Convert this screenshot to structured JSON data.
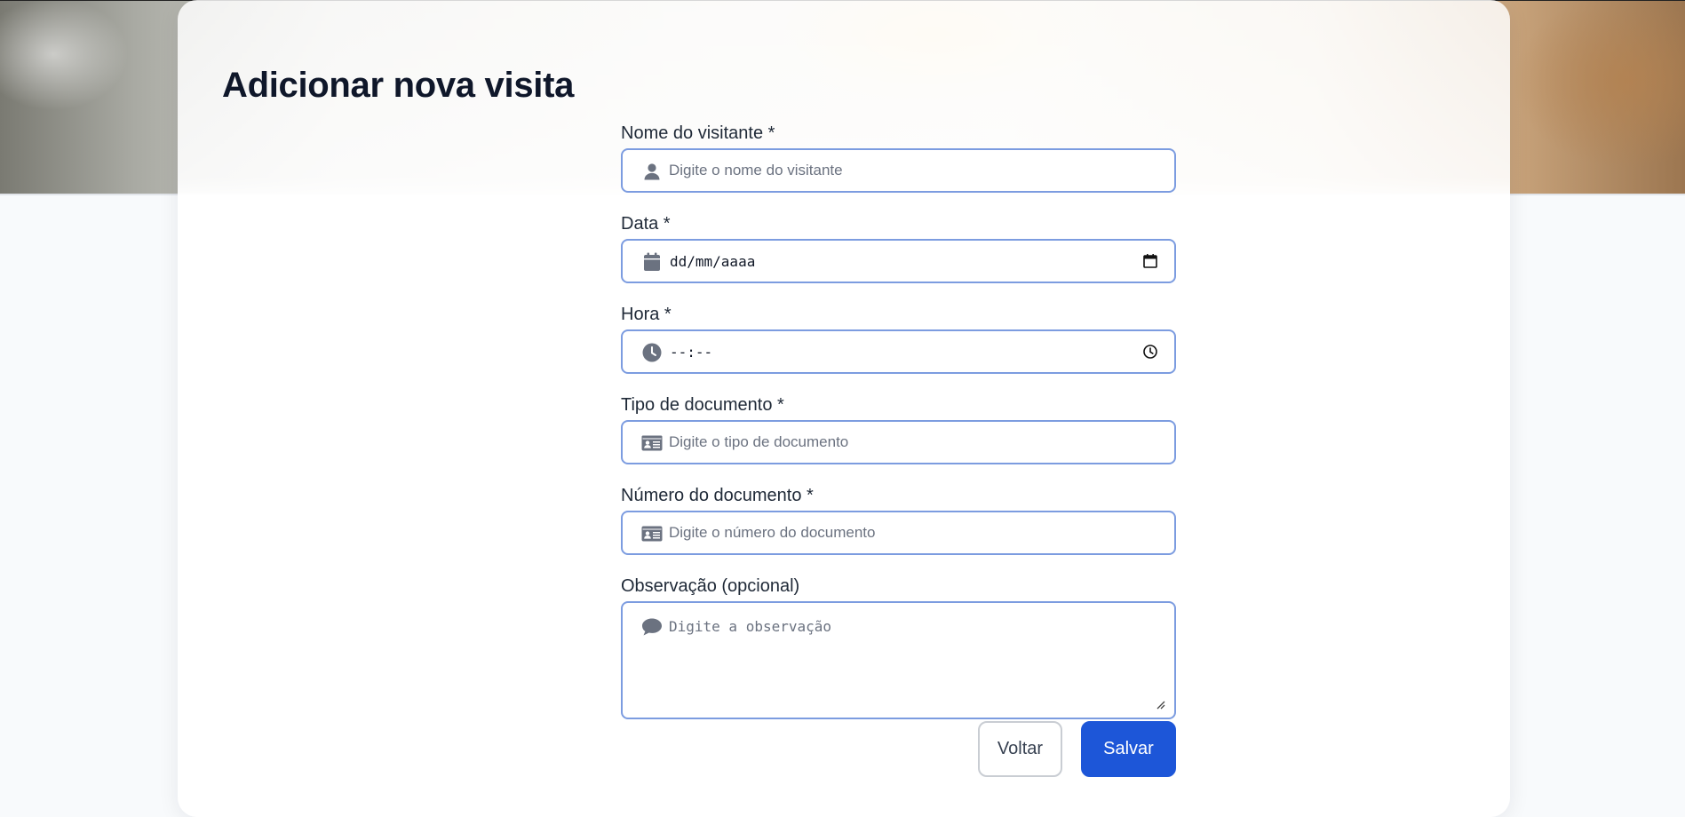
{
  "page": {
    "title": "Adicionar nova visita"
  },
  "form": {
    "visitor_name": {
      "label": "Nome do visitante *",
      "placeholder": "Digite o nome do visitante",
      "icon": "user-icon"
    },
    "date": {
      "label": "Data *",
      "placeholder": "dd/mm/aaaa",
      "icon": "calendar-icon"
    },
    "time": {
      "label": "Hora *",
      "placeholder": "--:--",
      "icon": "clock-icon"
    },
    "document_type": {
      "label": "Tipo de documento *",
      "placeholder": "Digite o tipo de documento",
      "icon": "id-card-icon"
    },
    "document_number": {
      "label": "Número do documento *",
      "placeholder": "Digite o número do documento",
      "icon": "id-card-icon"
    },
    "observation": {
      "label": "Observação (opcional)",
      "placeholder": "Digite a observação",
      "icon": "comment-icon"
    }
  },
  "actions": {
    "back_label": "Voltar",
    "save_label": "Salvar"
  },
  "colors": {
    "primary": "#1d56d8",
    "input_border": "#7c9ce0",
    "icon": "#6b7280",
    "title": "#0f172a"
  }
}
